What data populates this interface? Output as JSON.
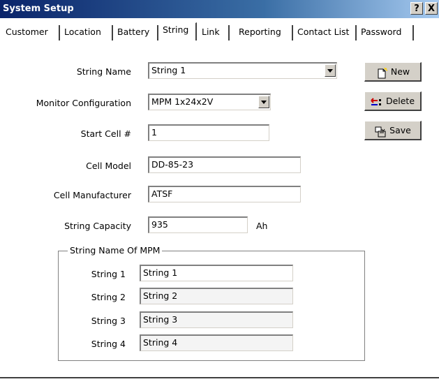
{
  "window": {
    "title": "System Setup",
    "help_btn": "?",
    "close_btn": "X"
  },
  "tabs": [
    {
      "label": "Customer"
    },
    {
      "label": "Location"
    },
    {
      "label": "Battery"
    },
    {
      "label": "String"
    },
    {
      "label": "Link"
    },
    {
      "label": "Reporting"
    },
    {
      "label": "Contact List"
    },
    {
      "label": "Password"
    }
  ],
  "form": {
    "string_name": {
      "label": "String Name",
      "value": "String 1"
    },
    "monitor_config": {
      "label": "Monitor Configuration",
      "value": "MPM 1x24x2V"
    },
    "start_cell": {
      "label": "Start Cell #",
      "value": "1"
    },
    "cell_model": {
      "label": "Cell Model",
      "value": "DD-85-23"
    },
    "cell_manufacturer": {
      "label": "Cell Manufacturer",
      "value": "ATSF"
    },
    "string_capacity": {
      "label": "String Capacity",
      "value": "935",
      "unit": "Ah"
    }
  },
  "buttons": {
    "new": "New",
    "delete": "Delete",
    "save": "Save"
  },
  "group": {
    "title": "String Name Of MPM",
    "rows": [
      {
        "label": "String 1",
        "value": "String 1"
      },
      {
        "label": "String 2",
        "value": "String 2"
      },
      {
        "label": "String 3",
        "value": "String 3"
      },
      {
        "label": "String 4",
        "value": "String 4"
      }
    ]
  },
  "colors": {
    "titlebar": "#0a246a",
    "face": "#d4d0c8"
  }
}
